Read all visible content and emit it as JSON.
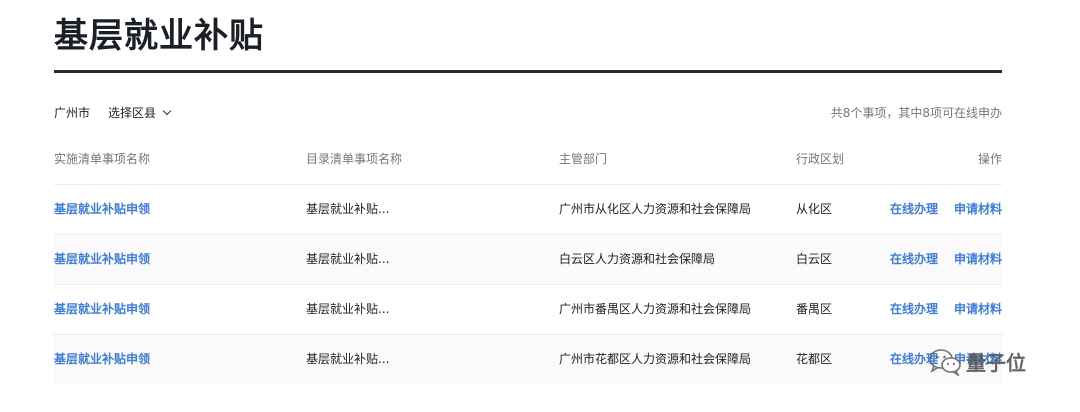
{
  "page": {
    "title": "基层就业补贴"
  },
  "filters": {
    "city": "广州市",
    "district_select": "选择区县",
    "summary": "共8个事项，其中8项可在线申办"
  },
  "table": {
    "headers": [
      "实施清单事项名称",
      "目录清单事项名称",
      "主管部门",
      "行政区划",
      "操作"
    ],
    "rows": [
      {
        "item": "基层就业补贴申领",
        "catalog": "基层就业补贴...",
        "dept": "广州市从化区人力资源和社会保障局",
        "region": "从化区",
        "op1": "在线办理",
        "op2": "申请材料"
      },
      {
        "item": "基层就业补贴申领",
        "catalog": "基层就业补贴...",
        "dept": "白云区人力资源和社会保障局",
        "region": "白云区",
        "op1": "在线办理",
        "op2": "申请材料"
      },
      {
        "item": "基层就业补贴申领",
        "catalog": "基层就业补贴...",
        "dept": "广州市番禺区人力资源和社会保障局",
        "region": "番禺区",
        "op1": "在线办理",
        "op2": "申请材料"
      },
      {
        "item": "基层就业补贴申领",
        "catalog": "基层就业补贴...",
        "dept": "广州市花都区人力资源和社会保障局",
        "region": "花都区",
        "op1": "在线办理",
        "op2": "申请材料"
      }
    ]
  },
  "watermark": {
    "text": "量子位",
    "icon": "wechat-icon"
  },
  "colors": {
    "link": "#3f7ed8",
    "title_rule": "#262a31"
  }
}
